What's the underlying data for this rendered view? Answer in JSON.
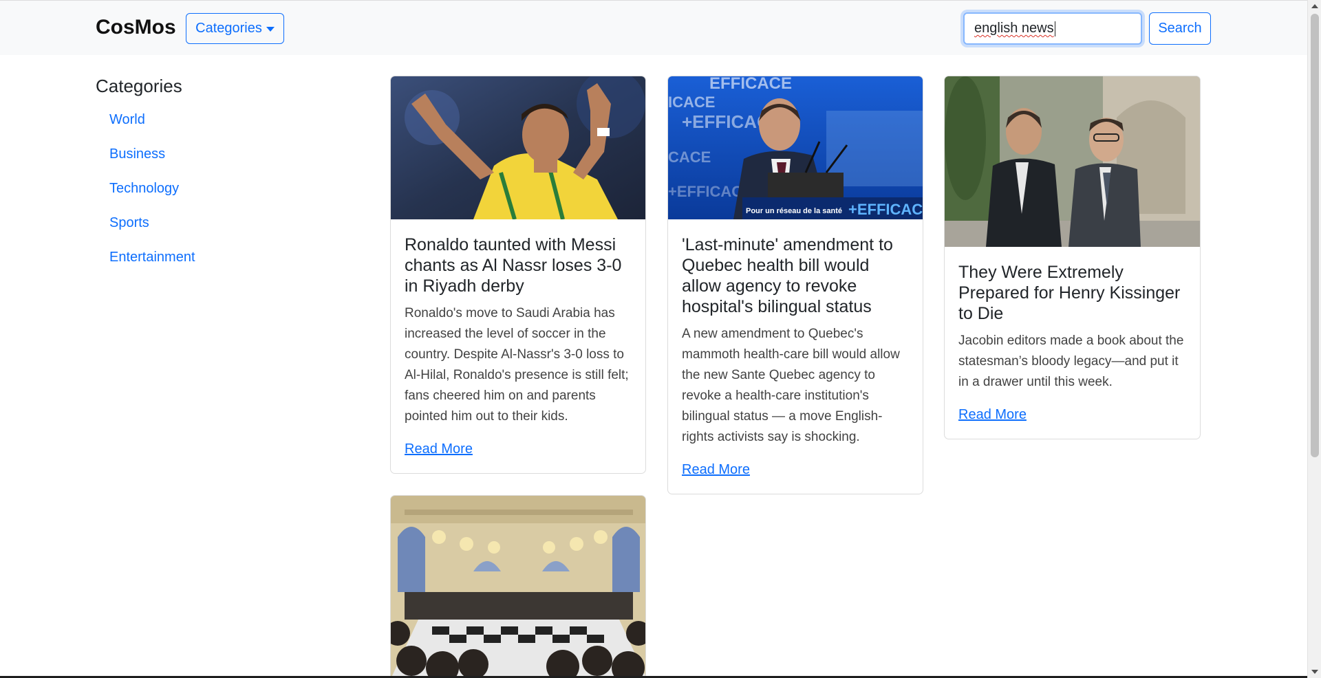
{
  "navbar": {
    "brand": "CosMos",
    "categories_button": "Categories",
    "search_value": "english news",
    "search_button": "Search"
  },
  "sidebar": {
    "title": "Categories",
    "items": [
      {
        "label": "World"
      },
      {
        "label": "Business"
      },
      {
        "label": "Technology"
      },
      {
        "label": "Sports"
      },
      {
        "label": "Entertainment"
      }
    ]
  },
  "articles": [
    {
      "title": "Ronaldo taunted with Messi chants as Al Nassr loses 3-0 in Riyadh derby",
      "description": "Ronaldo's move to Saudi Arabia has increased the level of soccer in the country. Despite Al-Nassr's 3-0 loss to Al-Hilal, Ronaldo's presence is still felt; fans cheered him on and parents pointed him out to their kids.",
      "link_label": "Read More"
    },
    {
      "title": "'Last-minute' amendment to Quebec health bill would allow agency to revoke hospital's bilingual status",
      "description": "A new amendment to Quebec's mammoth health-care bill would allow the new Sante Quebec agency to revoke a health-care institution's bilingual status — a move English-rights activists say is shocking.",
      "link_label": "Read More",
      "image_text": {
        "banner_words": [
          "EFFICACE",
          "ICACE",
          "+EFFICACE",
          "CACE",
          "+EFFICACE"
        ],
        "caption": "Pour un réseau de la santé",
        "caption_brand": "+EFFICACE"
      }
    },
    {
      "title": "They Were Extremely Prepared for Henry Kissinger to Die",
      "description": "Jacobin editors made a book about the statesman’s bloody legacy—and put it in a drawer until this week.",
      "link_label": "Read More"
    },
    {
      "title": "",
      "description": "",
      "link_label": ""
    }
  ],
  "colors": {
    "primary": "#0d6efd",
    "navbar_bg": "#f8f9fa",
    "text": "#212529"
  }
}
